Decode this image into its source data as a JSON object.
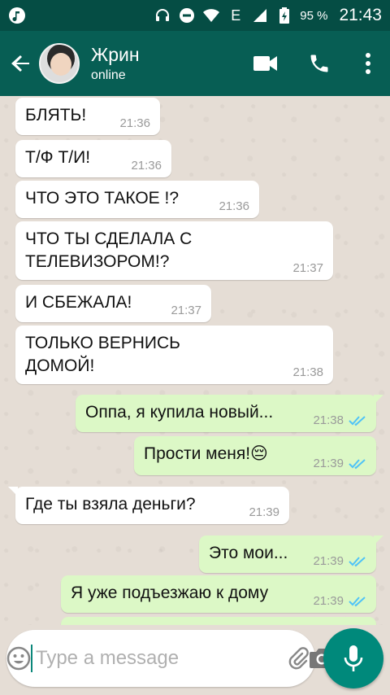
{
  "statusbar": {
    "battery": "95 %",
    "time": "21:43"
  },
  "header": {
    "name": "Жрин",
    "status": "online"
  },
  "messages": [
    {
      "dir": "in",
      "text": "БЛЯТЬ!",
      "time": "21:36"
    },
    {
      "dir": "in",
      "text": "Т/Ф Т/И!",
      "time": "21:36"
    },
    {
      "dir": "in",
      "text": "ЧТО ЭТО ТАКОЕ !?",
      "time": "21:36"
    },
    {
      "dir": "in",
      "text": " ЧТО ТЫ СДЕЛАЛА С ТЕЛЕВИЗОРОМ!?",
      "time": "21:37"
    },
    {
      "dir": "in",
      "text": "И СБЕЖАЛА!",
      "time": "21:37"
    },
    {
      "dir": "in",
      "text": "ТОЛЬКО ВЕРНИСЬ ДОМОЙ!",
      "time": "21:38"
    },
    {
      "dir": "out",
      "text": "Оппа, я купила новый...",
      "time": "21:38"
    },
    {
      "dir": "out",
      "text": "Прости меня!😔",
      "time": "21:39"
    },
    {
      "dir": "in",
      "text": "Где ты взяла деньги?",
      "time": "21:39"
    },
    {
      "dir": "out",
      "text": "Это мои...",
      "time": "21:39"
    },
    {
      "dir": "out",
      "text": "Я уже подъезжаю к дому",
      "time": "21:39"
    }
  ],
  "composer": {
    "placeholder": "Type a message"
  },
  "colors": {
    "appbar": "#075e54",
    "statusbar": "#054d44",
    "outgoing": "#dcf8c6",
    "accent": "#00897b",
    "tick": "#4fc3f7"
  }
}
